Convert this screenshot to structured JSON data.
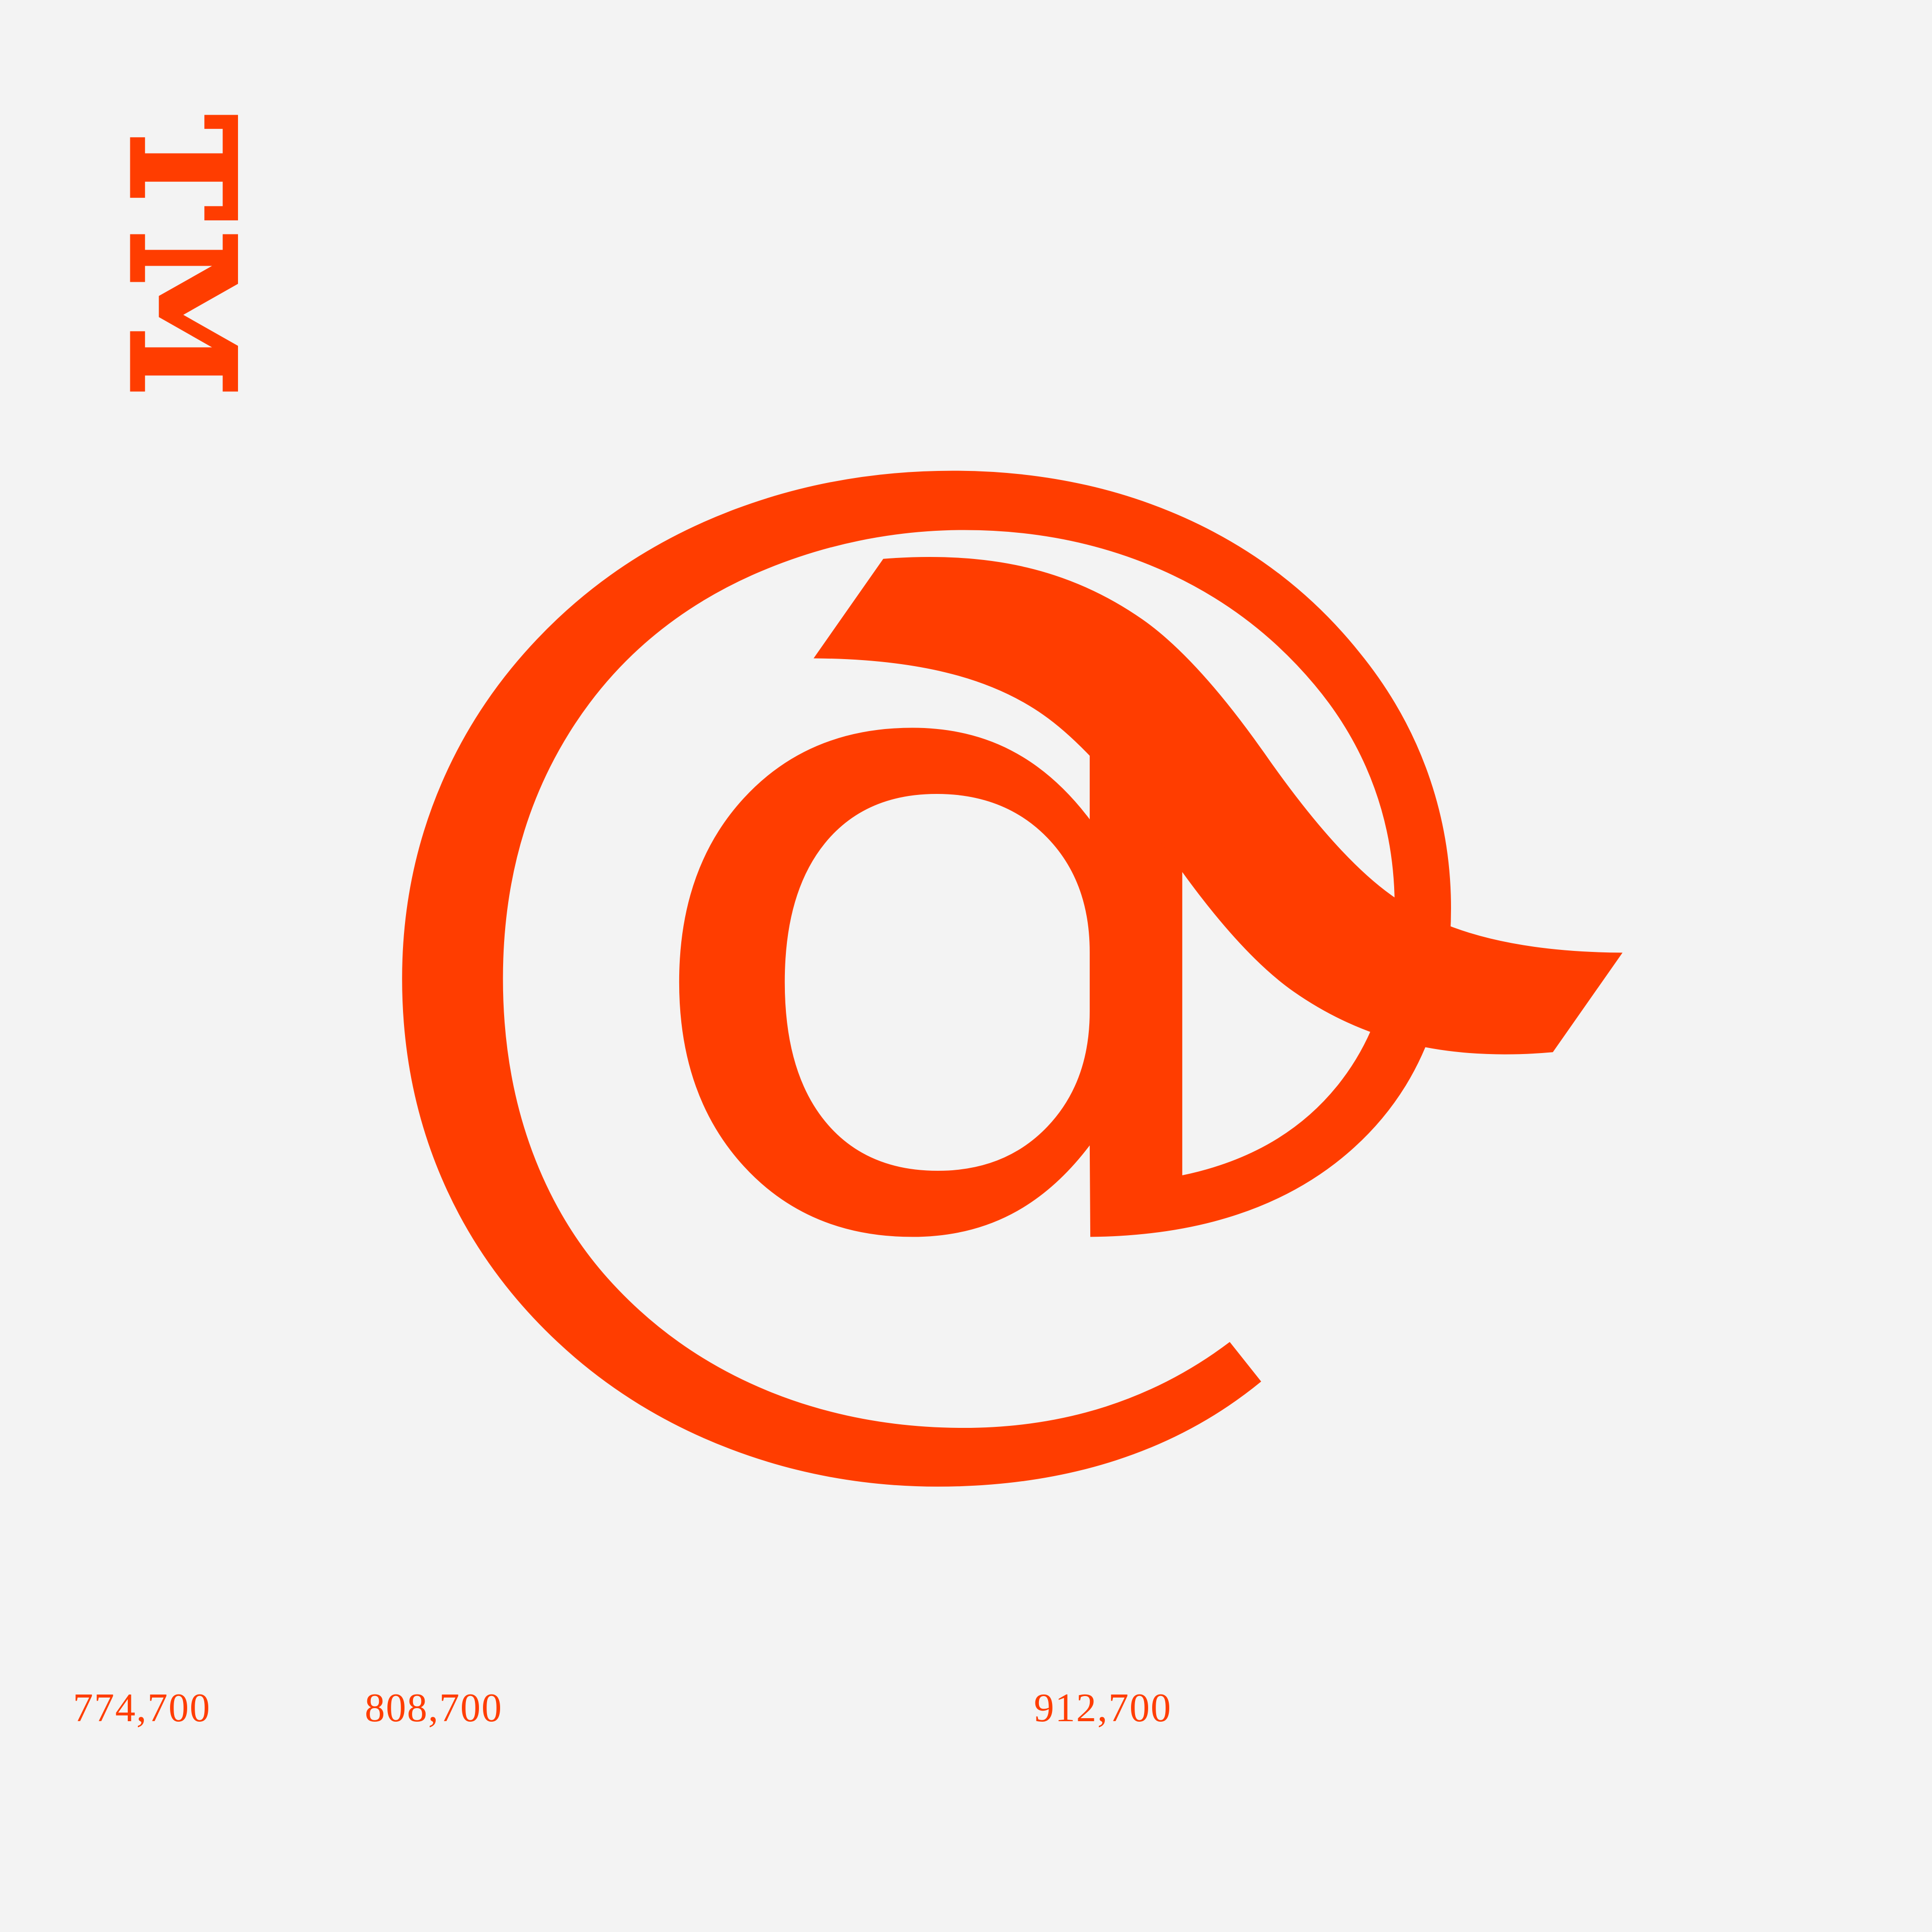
{
  "glyphs": {
    "trademark": "™",
    "at_sign": "@",
    "tilde": "~"
  },
  "labels": [
    {
      "text": "774,700"
    },
    {
      "text": "808,700"
    },
    {
      "text": "912,700"
    }
  ],
  "colors": {
    "accent": "#ff3d00",
    "background": "#f3f3f3"
  }
}
